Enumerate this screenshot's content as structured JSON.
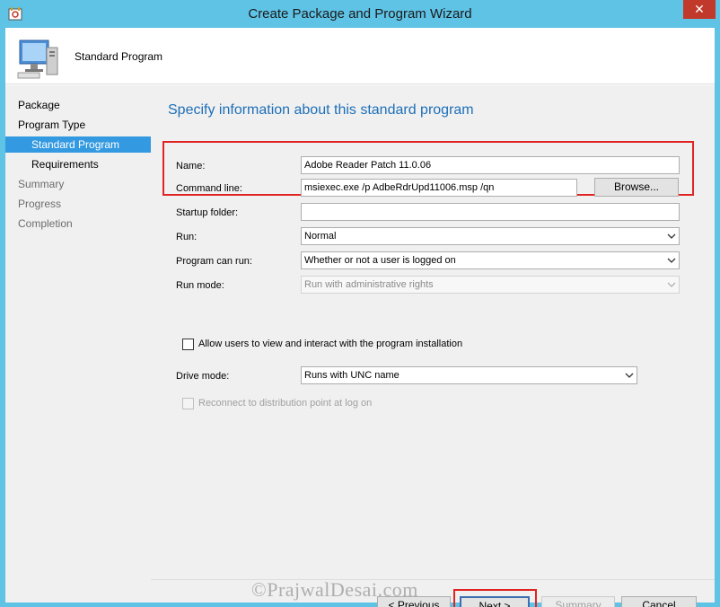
{
  "window": {
    "title": "Create Package and Program Wizard"
  },
  "header": {
    "title": "Standard Program"
  },
  "sidebar": {
    "items": [
      {
        "label": "Package"
      },
      {
        "label": "Program Type"
      },
      {
        "label": "Standard Program"
      },
      {
        "label": "Requirements"
      },
      {
        "label": "Summary"
      },
      {
        "label": "Progress"
      },
      {
        "label": "Completion"
      }
    ]
  },
  "main": {
    "heading": "Specify information about this standard program",
    "name_label": "Name:",
    "name_value": "Adobe Reader Patch 11.0.06",
    "command_label": "Command line:",
    "command_value": "msiexec.exe /p AdbeRdrUpd11006.msp /qn",
    "browse_label": "Browse...",
    "startup_label": "Startup folder:",
    "startup_value": "",
    "run_label": "Run:",
    "run_value": "Normal",
    "can_run_label": "Program can run:",
    "can_run_value": "Whether or not a user is logged on",
    "run_mode_label": "Run mode:",
    "run_mode_value": "Run with administrative rights",
    "allow_interact_label": "Allow users to view and interact with the program installation",
    "drive_mode_label": "Drive mode:",
    "drive_mode_value": "Runs with UNC name",
    "reconnect_label": "Reconnect to distribution point at log on"
  },
  "footer": {
    "previous_label": "< Previous",
    "next_label": "Next >",
    "summary_label": "Summary",
    "cancel_label": "Cancel"
  },
  "watermark": "©PrajwalDesai.com",
  "colors": {
    "accent": "#3399e0",
    "title_bar": "#5fc3e6",
    "highlight": "#e02424",
    "heading": "#1e6fb8"
  }
}
